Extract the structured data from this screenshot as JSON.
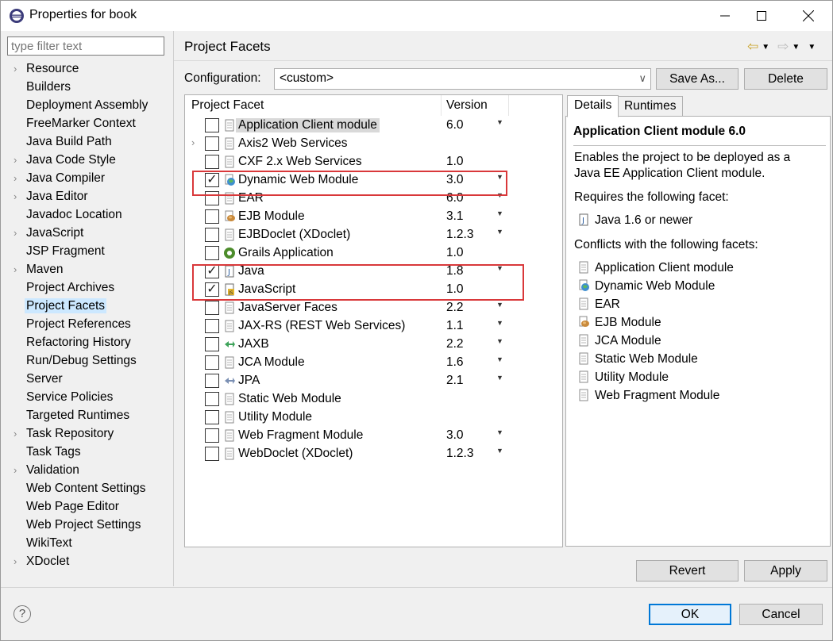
{
  "window": {
    "title": "Properties for book"
  },
  "filter": {
    "placeholder": "type filter text"
  },
  "sidebar": {
    "items": [
      {
        "label": "Resource",
        "expandable": true
      },
      {
        "label": "Builders",
        "expandable": false
      },
      {
        "label": "Deployment Assembly",
        "expandable": false
      },
      {
        "label": "FreeMarker Context",
        "expandable": false
      },
      {
        "label": "Java Build Path",
        "expandable": false
      },
      {
        "label": "Java Code Style",
        "expandable": true
      },
      {
        "label": "Java Compiler",
        "expandable": true
      },
      {
        "label": "Java Editor",
        "expandable": true
      },
      {
        "label": "Javadoc Location",
        "expandable": false
      },
      {
        "label": "JavaScript",
        "expandable": true
      },
      {
        "label": "JSP Fragment",
        "expandable": false
      },
      {
        "label": "Maven",
        "expandable": true
      },
      {
        "label": "Project Archives",
        "expandable": false
      },
      {
        "label": "Project Facets",
        "expandable": false,
        "selected": true
      },
      {
        "label": "Project References",
        "expandable": false
      },
      {
        "label": "Refactoring History",
        "expandable": false
      },
      {
        "label": "Run/Debug Settings",
        "expandable": false
      },
      {
        "label": "Server",
        "expandable": false
      },
      {
        "label": "Service Policies",
        "expandable": false
      },
      {
        "label": "Targeted Runtimes",
        "expandable": false
      },
      {
        "label": "Task Repository",
        "expandable": true
      },
      {
        "label": "Task Tags",
        "expandable": false
      },
      {
        "label": "Validation",
        "expandable": true
      },
      {
        "label": "Web Content Settings",
        "expandable": false
      },
      {
        "label": "Web Page Editor",
        "expandable": false
      },
      {
        "label": "Web Project Settings",
        "expandable": false
      },
      {
        "label": "WikiText",
        "expandable": false
      },
      {
        "label": "XDoclet",
        "expandable": true
      }
    ]
  },
  "page": {
    "title": "Project Facets"
  },
  "configuration": {
    "label": "Configuration:",
    "value": "<custom>",
    "save_as": "Save As...",
    "delete": "Delete"
  },
  "facets": {
    "col_facet": "Project Facet",
    "col_version": "Version",
    "rows": [
      {
        "name": "Application Client module",
        "version": "6.0",
        "checked": false,
        "dropdown": true,
        "icon": "page-icon",
        "highlight": true
      },
      {
        "name": "Axis2 Web Services",
        "version": "",
        "checked": false,
        "dropdown": false,
        "icon": "page-icon",
        "expandable": true
      },
      {
        "name": "CXF 2.x Web Services",
        "version": "1.0",
        "checked": false,
        "dropdown": false,
        "icon": "page-icon"
      },
      {
        "name": "Dynamic Web Module",
        "version": "3.0",
        "checked": true,
        "dropdown": true,
        "icon": "globe-icon"
      },
      {
        "name": "EAR",
        "version": "6.0",
        "checked": false,
        "dropdown": true,
        "icon": "page-icon"
      },
      {
        "name": "EJB Module",
        "version": "3.1",
        "checked": false,
        "dropdown": true,
        "icon": "bean-icon"
      },
      {
        "name": "EJBDoclet (XDoclet)",
        "version": "1.2.3",
        "checked": false,
        "dropdown": true,
        "icon": "page-icon"
      },
      {
        "name": "Grails Application",
        "version": "1.0",
        "checked": false,
        "dropdown": false,
        "icon": "grails-icon"
      },
      {
        "name": "Java",
        "version": "1.8",
        "checked": true,
        "dropdown": true,
        "icon": "java-icon"
      },
      {
        "name": "JavaScript",
        "version": "1.0",
        "checked": true,
        "dropdown": false,
        "icon": "js-icon"
      },
      {
        "name": "JavaServer Faces",
        "version": "2.2",
        "checked": false,
        "dropdown": true,
        "icon": "page-icon"
      },
      {
        "name": "JAX-RS (REST Web Services)",
        "version": "1.1",
        "checked": false,
        "dropdown": true,
        "icon": "page-icon"
      },
      {
        "name": "JAXB",
        "version": "2.2",
        "checked": false,
        "dropdown": true,
        "icon": "jaxb-icon"
      },
      {
        "name": "JCA Module",
        "version": "1.6",
        "checked": false,
        "dropdown": true,
        "icon": "page-icon"
      },
      {
        "name": "JPA",
        "version": "2.1",
        "checked": false,
        "dropdown": true,
        "icon": "jpa-icon"
      },
      {
        "name": "Static Web Module",
        "version": "",
        "checked": false,
        "dropdown": false,
        "icon": "page-icon"
      },
      {
        "name": "Utility Module",
        "version": "",
        "checked": false,
        "dropdown": false,
        "icon": "page-icon"
      },
      {
        "name": "Web Fragment Module",
        "version": "3.0",
        "checked": false,
        "dropdown": true,
        "icon": "page-icon"
      },
      {
        "name": "WebDoclet (XDoclet)",
        "version": "1.2.3",
        "checked": false,
        "dropdown": true,
        "icon": "page-icon"
      }
    ]
  },
  "details": {
    "tab_details": "Details",
    "tab_runtimes": "Runtimes",
    "title": "Application Client module 6.0",
    "desc_line1": "Enables the project to be deployed as a",
    "desc_line2": "Java EE Application Client module.",
    "requires_label": "Requires the following facet:",
    "requires": [
      {
        "label": "Java 1.6 or newer",
        "icon": "java-icon"
      }
    ],
    "conflicts_label": "Conflicts with the following facets:",
    "conflicts": [
      {
        "label": "Application Client module",
        "icon": "page-icon"
      },
      {
        "label": "Dynamic Web Module",
        "icon": "globe-icon"
      },
      {
        "label": "EAR",
        "icon": "page-icon"
      },
      {
        "label": "EJB Module",
        "icon": "bean-icon"
      },
      {
        "label": "JCA Module",
        "icon": "page-icon"
      },
      {
        "label": "Static Web Module",
        "icon": "page-icon"
      },
      {
        "label": "Utility Module",
        "icon": "page-icon"
      },
      {
        "label": "Web Fragment Module",
        "icon": "page-icon"
      }
    ]
  },
  "buttons": {
    "revert": "Revert",
    "apply": "Apply",
    "ok": "OK",
    "cancel": "Cancel",
    "help": "?"
  },
  "colors": {
    "highlight_box": "#d9383a",
    "selection": "#cce8ff",
    "ok_border": "#0078d7"
  }
}
